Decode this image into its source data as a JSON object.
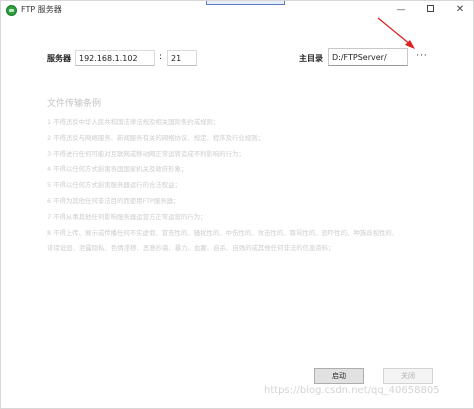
{
  "window": {
    "title": "FTP 服务器",
    "minimize_glyph": "—",
    "close_glyph": "✕"
  },
  "server": {
    "label": "服务器",
    "ip": "192.168.1.102",
    "colon": ":",
    "port": "21"
  },
  "root": {
    "label": "主目录",
    "path": "D:/FTPServer/",
    "browse_label": "···"
  },
  "terms": {
    "title": "文件传输条例",
    "items": [
      "1 不得违反中华人民共和国法律法规及相关国际条约或规则；",
      "2 不得违反与网络服务、新闻服务有关的网络协议、规定、程序及行业规则；",
      "3 不得进行任何可能对互联网或移动网正常运转造成不利影响的行为；",
      "4 不得以任何方式损害各国国家机关及政府形象；",
      "5 不得以任何方式损害服务器运行的合法权益；",
      "6 不得为其他任何非法目的而使用FTP服务器；",
      "7 不得从事其他任何影响服务器运营方正常运营的行为；",
      "8 不得上传、展示或传播任何不实虚假、冒充性的、骚扰性的、中伤性的、攻击性的、辱骂性的、恐吓性的、种族歧视性的、",
      "诽谤诋毁、泄露隐私、色情淫秽、恶意抄袭、暴力、血腥、自杀、自残的或其他任何非法的信息资料；"
    ]
  },
  "buttons": {
    "start": "启动",
    "stop": "关闭"
  },
  "watermark": "https://blog.csdn.net/qq_40658805",
  "colors": {
    "annotation_arrow": "#e02020",
    "app_icon": "#2e9e3e"
  }
}
